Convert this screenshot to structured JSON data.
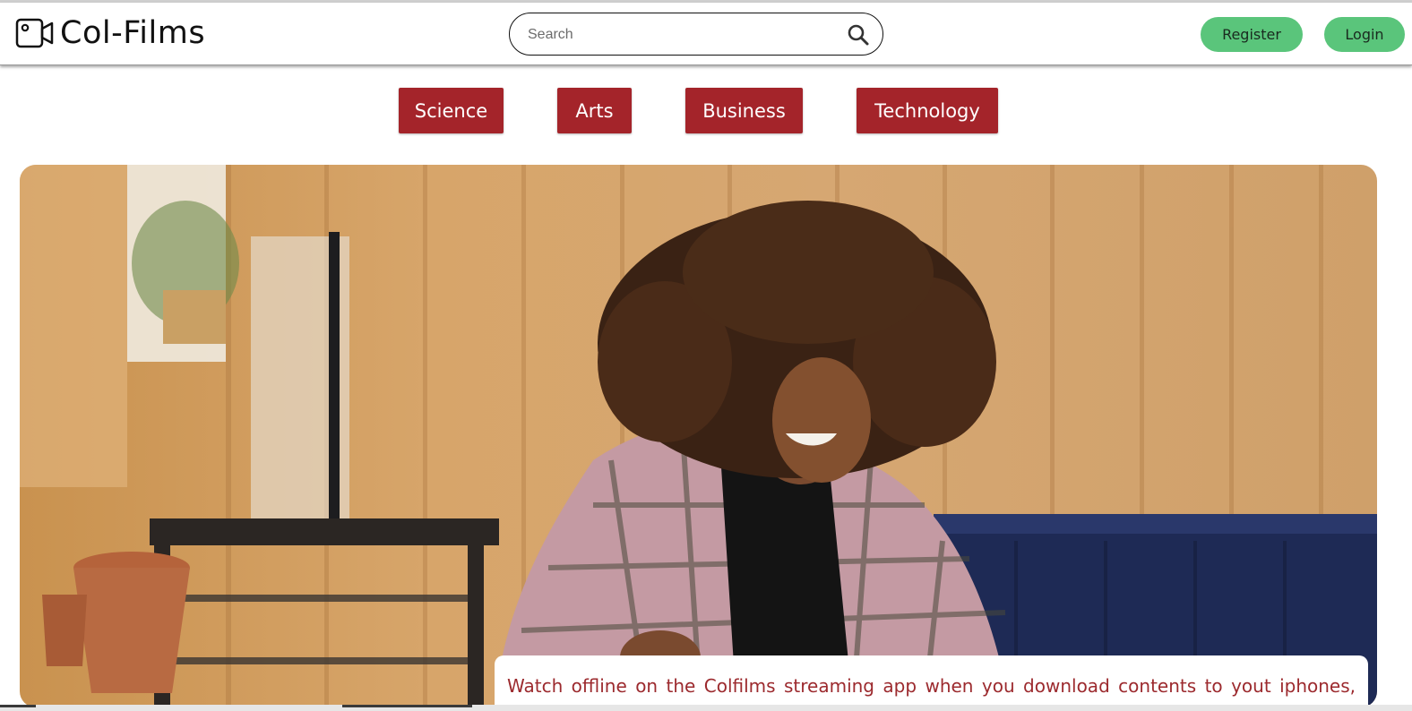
{
  "header": {
    "brand": "Col-Films",
    "search_placeholder": "Search",
    "register_label": "Register",
    "login_label": "Login"
  },
  "categories": [
    "Science",
    "Arts",
    "Business",
    "Technology"
  ],
  "hero": {
    "caption": "Watch offline on the Colfilms streaming app when you download contents to yout iphones,"
  },
  "colors": {
    "category_bg": "#a4242a",
    "auth_button_bg": "#5ac57b",
    "caption_text": "#9c2a2e"
  }
}
